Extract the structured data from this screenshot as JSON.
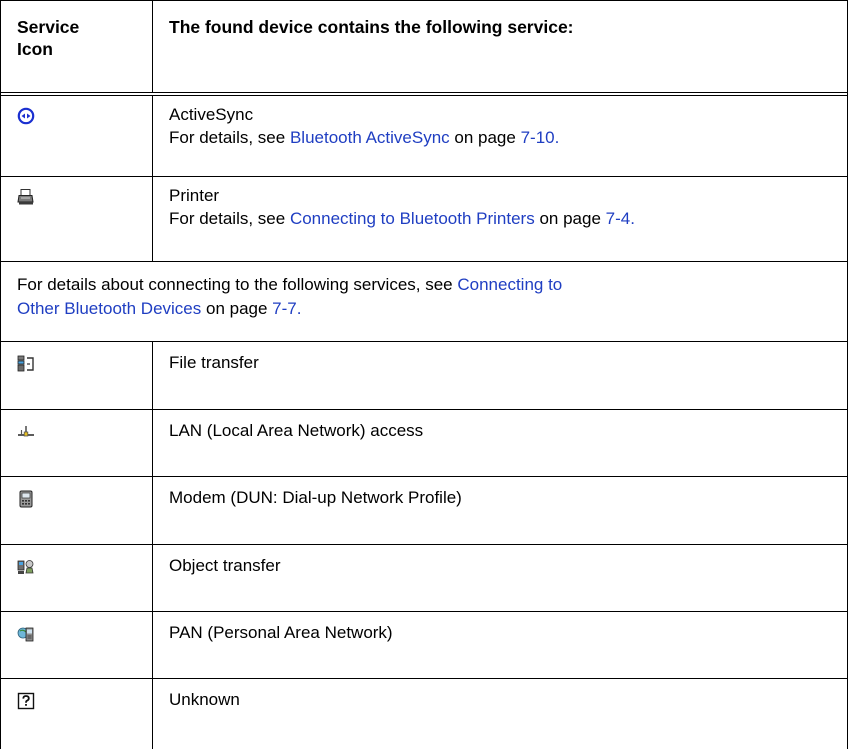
{
  "table": {
    "header": {
      "col1": "Service Icon",
      "col1_line1": "Service",
      "col1_line2": "Icon",
      "col2": "The found device contains the following service:"
    },
    "rows": [
      {
        "icon": "activesync-icon",
        "title": "ActiveSync",
        "details_prefix": "For details, see ",
        "details_link": "Bluetooth ActiveSync",
        "details_mid": " on page ",
        "details_page": "7-10."
      },
      {
        "icon": "printer-icon",
        "title": "Printer",
        "details_prefix": "For details, see ",
        "details_link": "Connecting to Bluetooth Printers",
        "details_mid": " on page ",
        "details_page": "7-4."
      }
    ],
    "span_note": {
      "prefix": "For details about connecting to the following services, see ",
      "link_line1": "Connecting to",
      "link_line2": "Other Bluetooth Devices",
      "mid": " on page ",
      "page": "7-7."
    },
    "services": [
      {
        "icon": "file-transfer-icon",
        "label": "File transfer"
      },
      {
        "icon": "lan-access-icon",
        "label": "LAN (Local Area Network) access"
      },
      {
        "icon": "modem-icon",
        "label": "Modem (DUN: Dial-up Network Profile)"
      },
      {
        "icon": "object-transfer-icon",
        "label": "Object transfer"
      },
      {
        "icon": "pan-icon",
        "label": "PAN (Personal Area Network)"
      },
      {
        "icon": "unknown-icon",
        "label": "Unknown"
      }
    ]
  },
  "colors": {
    "link": "#1f3ec2",
    "border": "#000000"
  }
}
